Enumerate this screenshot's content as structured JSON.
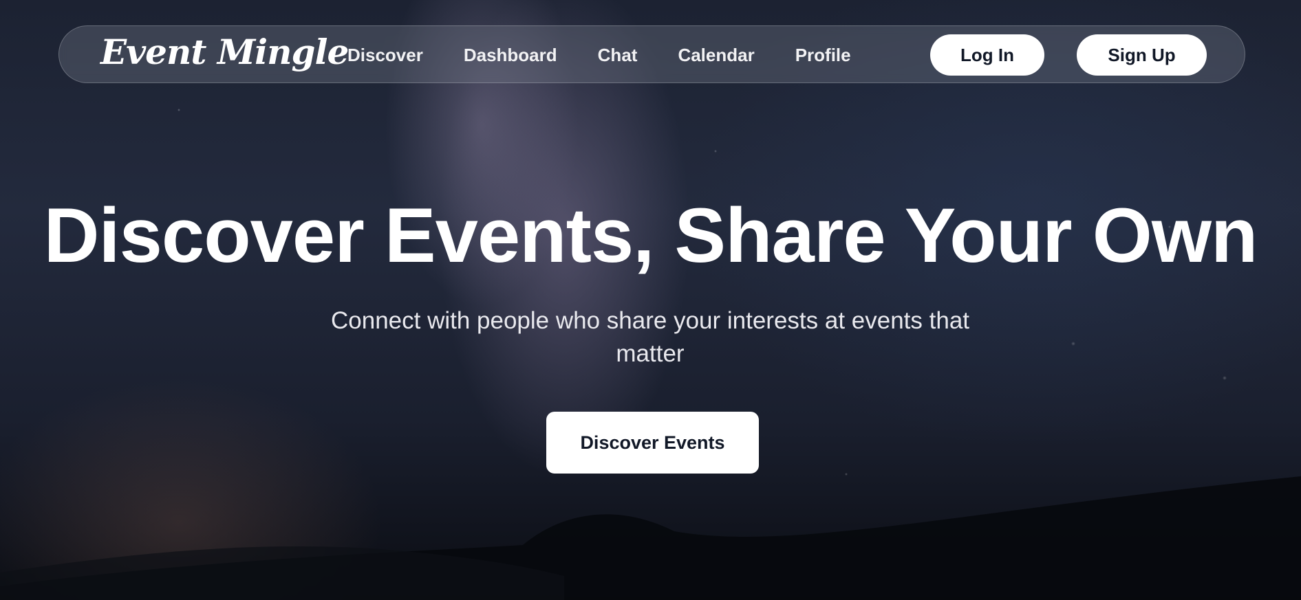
{
  "brand": {
    "logo_text": "Event Mingle"
  },
  "nav": {
    "links": [
      {
        "label": "Discover"
      },
      {
        "label": "Dashboard"
      },
      {
        "label": "Chat"
      },
      {
        "label": "Calendar"
      },
      {
        "label": "Profile"
      }
    ],
    "login_label": "Log In",
    "signup_label": "Sign Up"
  },
  "hero": {
    "title": "Discover Events, Share Your Own",
    "subtitle": "Connect with people who share your interests at events that matter",
    "cta_label": "Discover Events"
  },
  "colors": {
    "button_bg": "#ffffff",
    "button_text": "#111827",
    "text_primary": "#ffffff"
  }
}
